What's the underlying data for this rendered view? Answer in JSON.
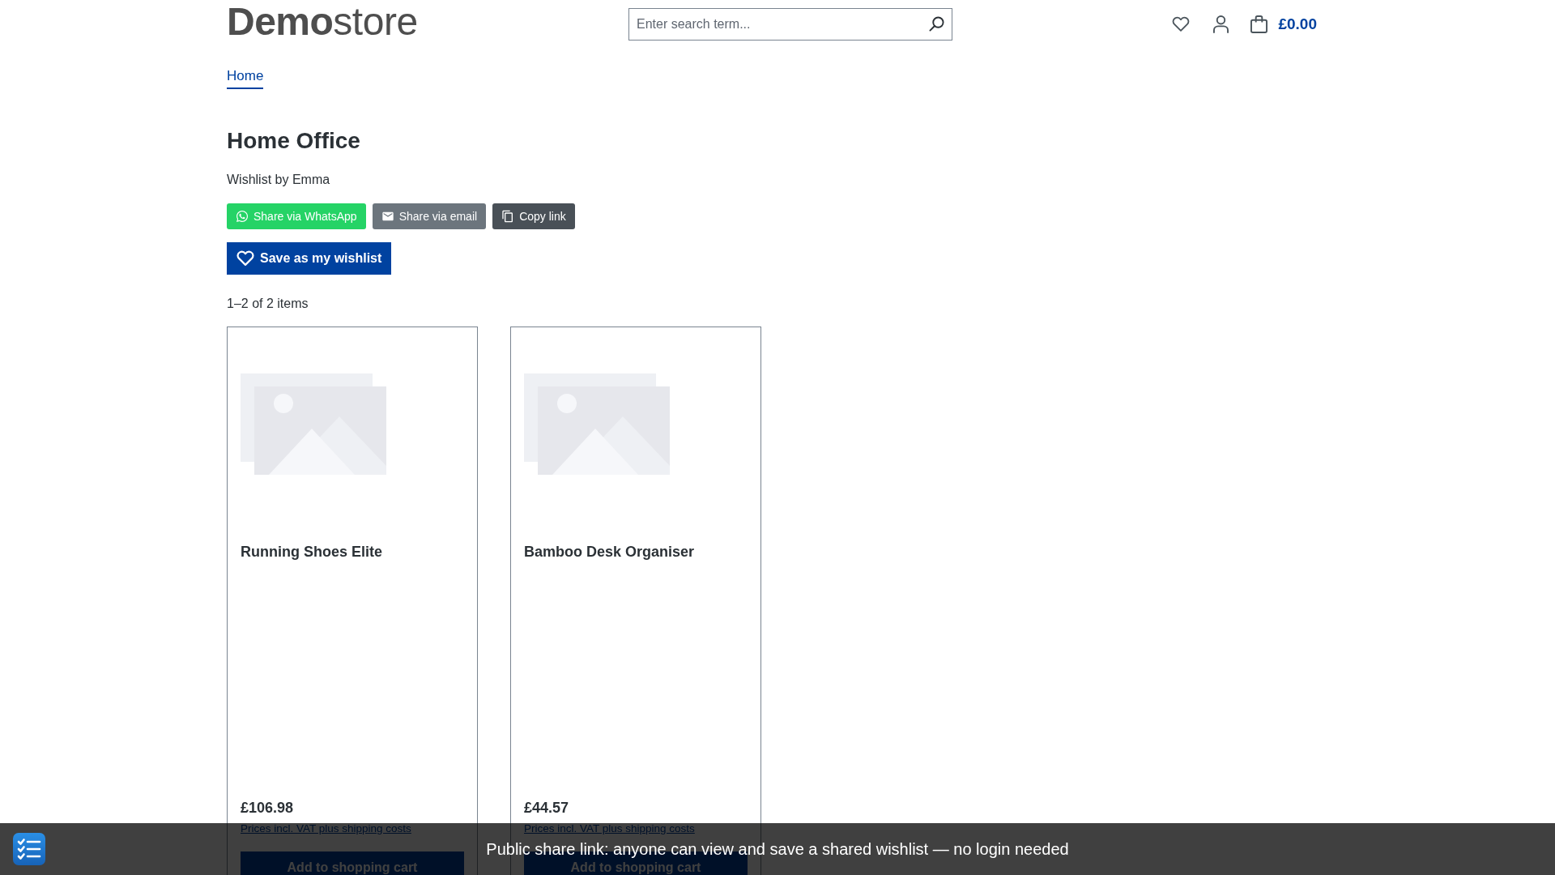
{
  "header": {
    "logo": "**Demo**store",
    "search": {
      "placeholder": "Enter search term..."
    },
    "cart_total": "£0.00"
  },
  "breadcrumb": [
    "Home"
  ],
  "wishlist": {
    "title": "Home Office",
    "owner": "Wishlist by Emma",
    "share_buttons": [
      {
        "kind": "whatsapp",
        "label": "Share via WhatsApp"
      },
      {
        "kind": "email",
        "label": "Share via email"
      },
      {
        "kind": "copy",
        "label": "Copy link"
      }
    ],
    "save_button": "Save as my wishlist",
    "item_count": "1–2 of 2 items"
  },
  "products": [
    {
      "name": "Running Shoes Elite",
      "price": "£106.98",
      "tax_note": "Prices incl. VAT plus shipping costs",
      "button": "Add to shopping cart"
    },
    {
      "name": "Bamboo Desk Organiser",
      "price": "£44.57",
      "tax_note": "Prices incl. VAT plus shipping costs",
      "button": "Add to shopping cart"
    }
  ],
  "notice_bar": {
    "text": "Public share link: anyone can view and save a shared wishlist — no login needed"
  }
}
